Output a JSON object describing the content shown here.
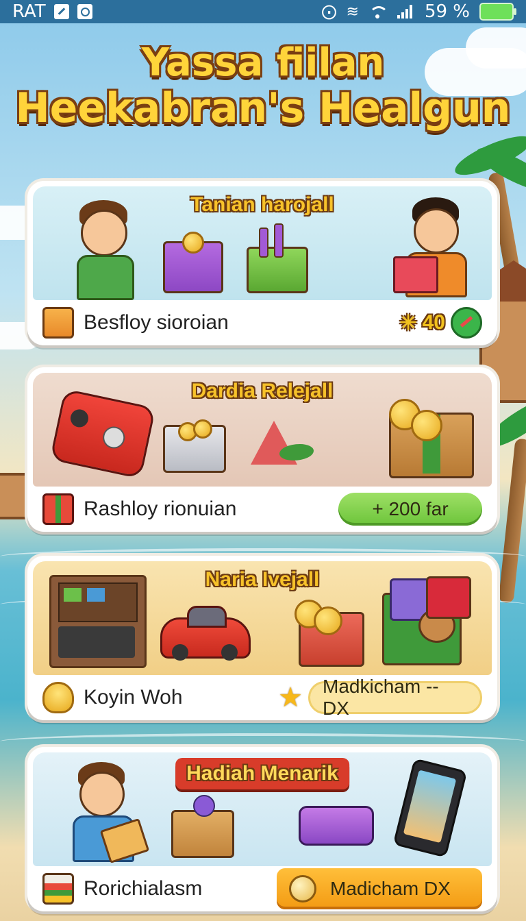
{
  "status_bar": {
    "carrier": "RAT",
    "battery_percent": "59 %",
    "icons": [
      "edit-icon",
      "camera-icon",
      "nfc-icon",
      "vibrate-icon",
      "wifi-icon",
      "signal-icon",
      "battery-icon"
    ]
  },
  "header": {
    "title_line1": "Yassa fiilan",
    "title_line2": "Heekabran's Healgun"
  },
  "cards": [
    {
      "title": "Tanian harojall",
      "label": "Besfloy sioroian",
      "action": "40",
      "art_items": [
        "waving-boy-illustration",
        "gift-box-icon",
        "green-box-icon",
        "boy-reading-illustration"
      ],
      "footer_icon": "shopping-bag-icon",
      "action_icon": "chat-bubble-icon"
    },
    {
      "title": "Dardia Relejall",
      "label": "Rashloy rionuian",
      "action": "+ 200 far",
      "art_items": [
        "game-console-illustration",
        "coin-tin-icon",
        "leaf-toy-icon",
        "treasure-chest-icon"
      ],
      "footer_icon": "gift-icon"
    },
    {
      "title": "Naria Ivejall",
      "label": "Koyin Woh",
      "action": "Madkicham -- DX",
      "art_items": [
        "toolbox-laptop-illustration",
        "red-car-illustration",
        "coin-chest-icon",
        "dog-laptop-illustration"
      ],
      "footer_icon": "cup-icon",
      "action_icon": "star-icon"
    },
    {
      "title": "Hadiah Menarik",
      "label": "Rorichialasm",
      "action": "Madicham  DX",
      "art_items": [
        "boy-with-book-illustration",
        "flower-box-icon",
        "purple-wallet-icon",
        "smartphone-illustration"
      ],
      "footer_icon": "basket-icon",
      "action_icon": "coin-bag-icon"
    }
  ],
  "colors": {
    "status_bar": "#2c6f9c",
    "title_fill": "#ffd43a",
    "title_outline": "#7a3f12",
    "card1_bg": "#cfeaf2",
    "card2_bg": "#ead2c4",
    "card3_bg": "#f6dca0",
    "card4_bg": "#d2e9f3",
    "pill_green": "#8cd556",
    "pill_orange": "#f7a91f"
  }
}
